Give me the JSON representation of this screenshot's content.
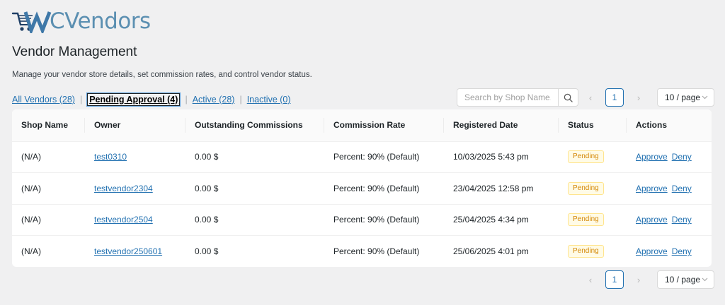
{
  "logo": {
    "text": "CVendors",
    "icon": "cart-w-logo-icon"
  },
  "page": {
    "title": "Vendor Management",
    "description": "Manage your vendor store details, set commission rates, and control vendor status."
  },
  "filters": [
    {
      "label": "All Vendors (28)"
    },
    {
      "label": "Pending Approval (4)",
      "current": true
    },
    {
      "label": "Active (28)"
    },
    {
      "label": "Inactive (0)"
    }
  ],
  "search": {
    "placeholder": "Search by Shop Name..."
  },
  "pagination": {
    "prev": "‹",
    "page": "1",
    "next": "›",
    "per_page": "10 / page"
  },
  "table": {
    "columns": [
      "Shop Name",
      "Owner",
      "Outstanding Commissions",
      "Commission Rate",
      "Registered Date",
      "Status",
      "Actions"
    ],
    "rows": [
      {
        "shop": "(N/A)",
        "owner": "test0310",
        "commission": "0.00 $",
        "rate": "Percent: 90% (Default)",
        "date": "10/03/2025 5:43 pm",
        "status": "Pending",
        "approve": "Approve",
        "deny": "Deny"
      },
      {
        "shop": "(N/A)",
        "owner": "testvendor2304",
        "commission": "0.00 $",
        "rate": "Percent: 90% (Default)",
        "date": "23/04/2025 12:58 pm",
        "status": "Pending",
        "approve": "Approve",
        "deny": "Deny"
      },
      {
        "shop": "(N/A)",
        "owner": "testvendor2504",
        "commission": "0.00 $",
        "rate": "Percent: 90% (Default)",
        "date": "25/04/2025 4:34 pm",
        "status": "Pending",
        "approve": "Approve",
        "deny": "Deny"
      },
      {
        "shop": "(N/A)",
        "owner": "testvendor250601",
        "commission": "0.00 $",
        "rate": "Percent: 90% (Default)",
        "date": "25/06/2025 4:01 pm",
        "status": "Pending",
        "approve": "Approve",
        "deny": "Deny"
      }
    ]
  },
  "colors": {
    "link": "#2271b1",
    "logo": "#5b8fb1",
    "badge_text": "#d48806",
    "badge_bg": "#fffbe6",
    "badge_border": "#ffe58f"
  }
}
